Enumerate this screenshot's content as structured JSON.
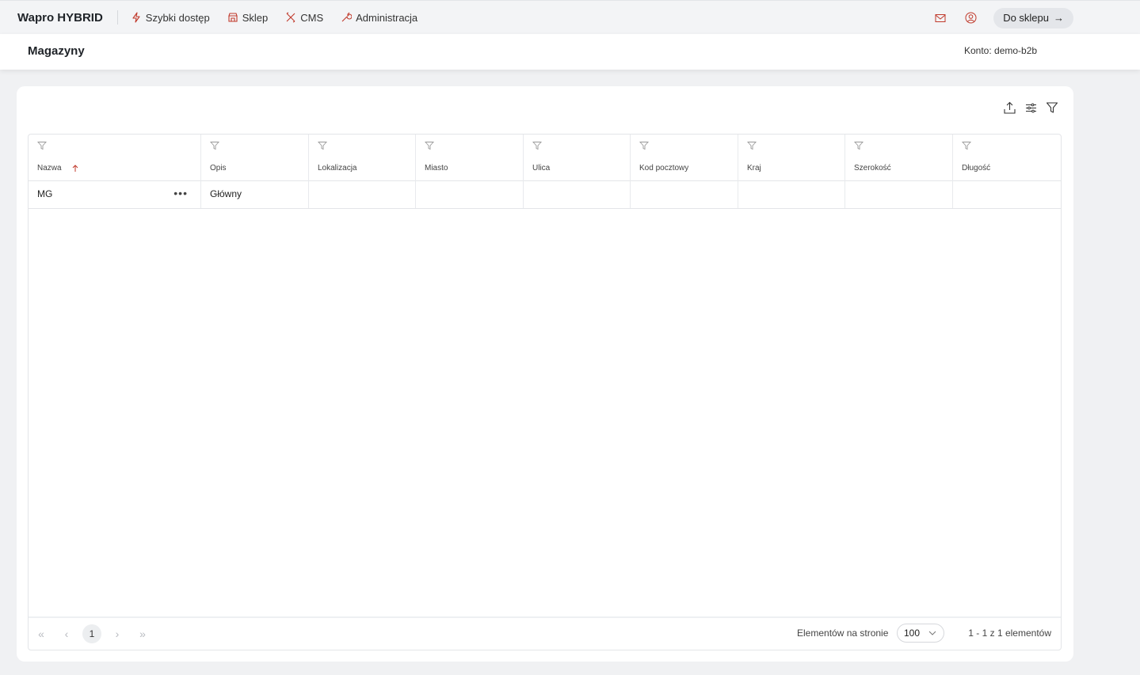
{
  "app": {
    "title": "Wapro HYBRID"
  },
  "nav": [
    {
      "label": "Szybki dostęp",
      "icon": "lightning-icon"
    },
    {
      "label": "Sklep",
      "icon": "store-icon"
    },
    {
      "label": "CMS",
      "icon": "tools-icon"
    },
    {
      "label": "Administracja",
      "icon": "wrench-icon"
    }
  ],
  "header_right": {
    "shop_button": "Do sklepu",
    "arrow": "→"
  },
  "page": {
    "title": "Magazyny",
    "account": "Konto: demo-b2b"
  },
  "table": {
    "columns": [
      "Nazwa",
      "Opis",
      "Lokalizacja",
      "Miasto",
      "Ulica",
      "Kod pocztowy",
      "Kraj",
      "Szerokość",
      "Długość"
    ],
    "rows": [
      [
        "MG",
        "Główny",
        "",
        "",
        "",
        "",
        "",
        "",
        ""
      ]
    ],
    "row_menu": "•••"
  },
  "pagination": {
    "first": "«",
    "prev": "‹",
    "current": "1",
    "next": "›",
    "last": "»",
    "per_page_label": "Elementów na stronie",
    "per_page_value": "100",
    "range": "1 - 1 z 1 elementów"
  },
  "colors": {
    "accent": "#c0392b",
    "bg": "#f0f1f3"
  }
}
